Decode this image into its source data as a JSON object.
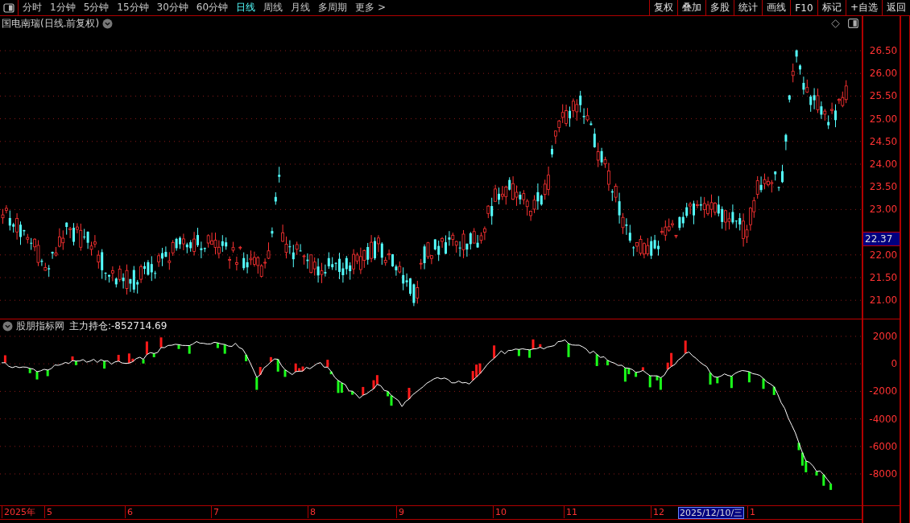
{
  "toolbar": {
    "periods": [
      {
        "label": "分时",
        "selected": false
      },
      {
        "label": "1分钟",
        "selected": false
      },
      {
        "label": "5分钟",
        "selected": false
      },
      {
        "label": "15分钟",
        "selected": false
      },
      {
        "label": "30分钟",
        "selected": false
      },
      {
        "label": "60分钟",
        "selected": false
      },
      {
        "label": "日线",
        "selected": true
      },
      {
        "label": "周线",
        "selected": false
      },
      {
        "label": "月线",
        "selected": false
      },
      {
        "label": "多周期",
        "selected": false
      },
      {
        "label": "更多 >",
        "selected": false
      }
    ],
    "buttons": [
      "复权",
      "叠加",
      "多股",
      "统计",
      "画线",
      "F10",
      "标记",
      "+自选",
      "返回"
    ]
  },
  "price_chart": {
    "title": "国电南瑞(日线.前复权)",
    "y_ticks": [
      "26.50",
      "26.00",
      "25.50",
      "25.00",
      "24.50",
      "24.00",
      "23.50",
      "23.00",
      "22.00",
      "21.50",
      "21.00"
    ],
    "current_price": "22.37"
  },
  "indicator": {
    "name": "股朋指标网",
    "label": "主力持仓:",
    "value": "-852714.69",
    "y_ticks": [
      "2000",
      "0",
      "-2000",
      "-4000",
      "-6000",
      "-8000"
    ]
  },
  "date_axis": {
    "labels": [
      "2025年",
      "5",
      "6",
      "7",
      "8",
      "9",
      "10",
      "11",
      "12",
      "1"
    ],
    "cursor_date": "2025/12/10/三"
  }
}
